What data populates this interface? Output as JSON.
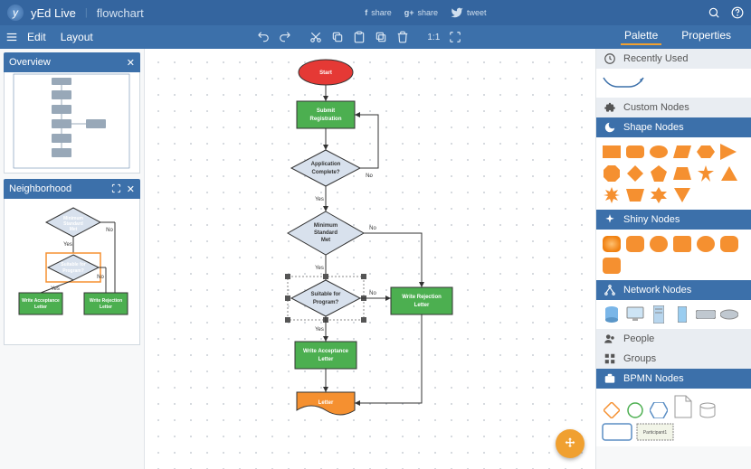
{
  "app": {
    "name": "yEd Live",
    "doc": "flowchart"
  },
  "social": {
    "fb": "share",
    "gp": "share",
    "tw": "tweet"
  },
  "menu": {
    "edit": "Edit",
    "layout": "Layout",
    "ratio": "1:1"
  },
  "tabs": {
    "palette": "Palette",
    "properties": "Properties"
  },
  "panels": {
    "overview": "Overview",
    "neighborhood": "Neighborhood"
  },
  "palette": {
    "recent": "Recently Used",
    "custom": "Custom Nodes",
    "shape": "Shape Nodes",
    "shiny": "Shiny Nodes",
    "network": "Network Nodes",
    "people": "People",
    "groups": "Groups",
    "bpmn": "BPMN Nodes",
    "participant": "Participant1"
  },
  "flow": {
    "start": "Start",
    "submit1": "Submit",
    "submit2": "Registration",
    "app1": "Application",
    "app2": "Complete?",
    "min1": "Minimum",
    "min2": "Standard",
    "min3": "Met",
    "suit1": "Suitable for",
    "suit2": "Program?",
    "acc1": "Write Acceptance",
    "acc2": "Letter",
    "rej1": "Write Rejection",
    "rej2": "Letter",
    "letter": "Letter",
    "yes": "Yes",
    "no": "No"
  },
  "nb": {
    "m1": "Minimum",
    "m2": "Standard",
    "m3": "Met",
    "s1": "Suitable for",
    "s2": "Program?",
    "a1": "Write Acceptance",
    "a2": "Letter",
    "r1": "Write Rejection",
    "r2": "Letter",
    "yes": "Yes",
    "no": "No"
  }
}
